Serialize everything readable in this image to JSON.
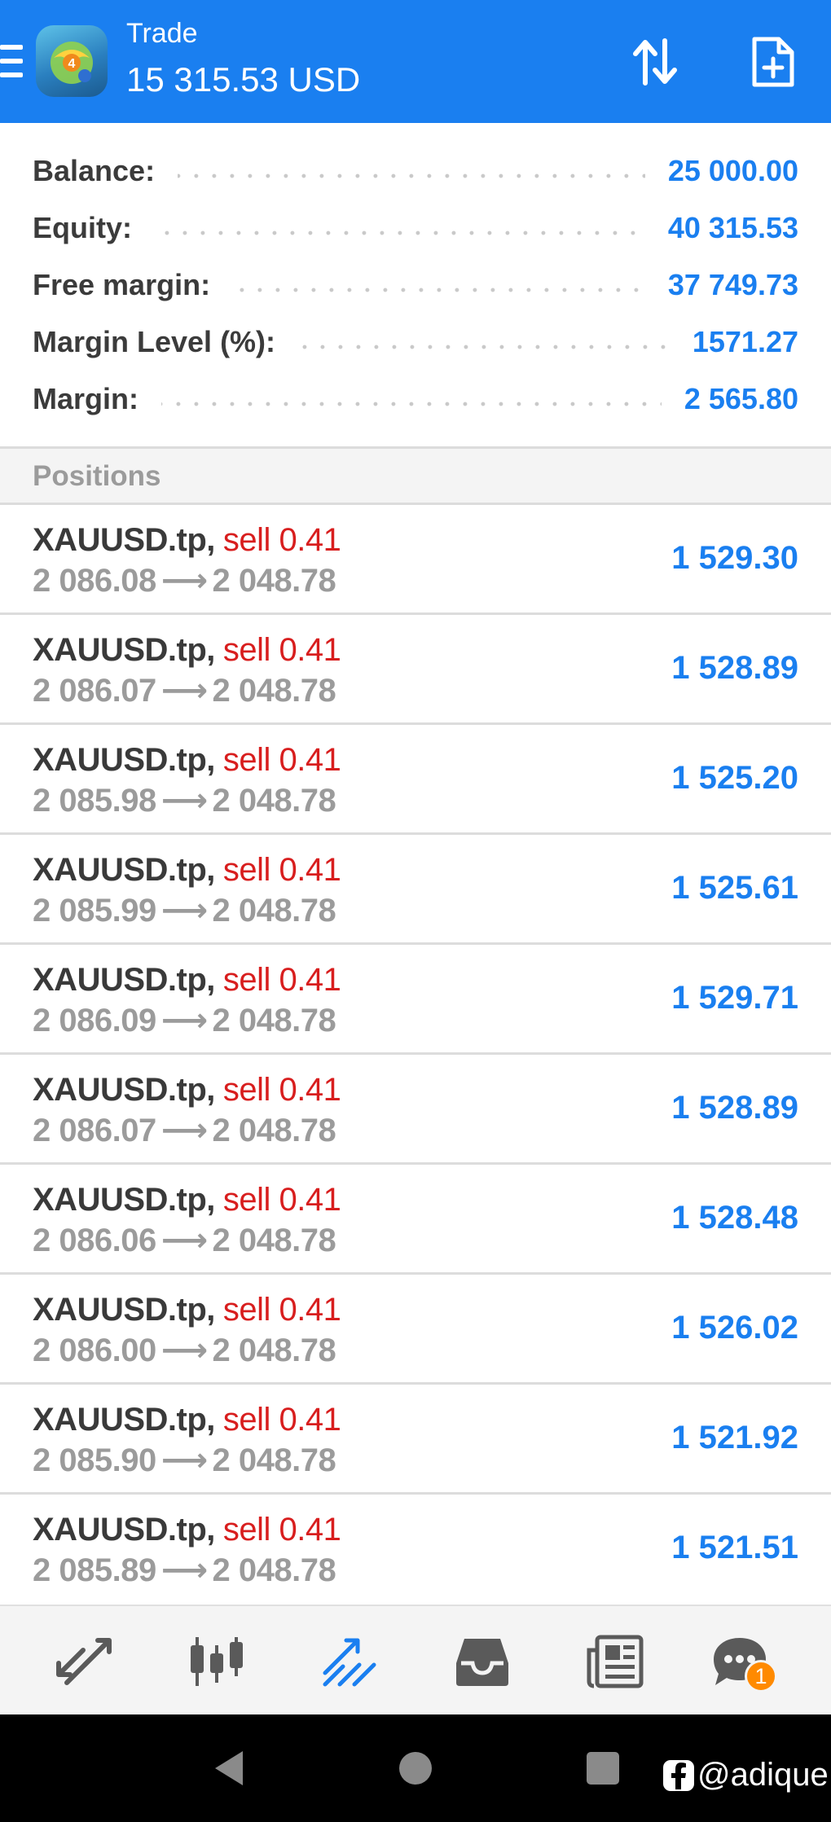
{
  "header": {
    "title": "Trade",
    "subtitle": "15 315.53 USD",
    "icons": [
      "menu-icon",
      "mt4-app-logo",
      "sort-icon",
      "new-order-icon"
    ]
  },
  "summary": [
    {
      "label": "Balance:",
      "value": "25 000.00"
    },
    {
      "label": "Equity:",
      "value": "40 315.53"
    },
    {
      "label": "Free margin:",
      "value": "37 749.73"
    },
    {
      "label": "Margin Level (%):",
      "value": "1571.27"
    },
    {
      "label": "Margin:",
      "value": "2 565.80"
    }
  ],
  "positions_header": "Positions",
  "positions": [
    {
      "symbol": "XAUUSD.tp",
      "side": "sell 0.41",
      "open": "2 086.08",
      "current": "2 048.78",
      "profit": "1 529.30"
    },
    {
      "symbol": "XAUUSD.tp",
      "side": "sell 0.41",
      "open": "2 086.07",
      "current": "2 048.78",
      "profit": "1 528.89"
    },
    {
      "symbol": "XAUUSD.tp",
      "side": "sell 0.41",
      "open": "2 085.98",
      "current": "2 048.78",
      "profit": "1 525.20"
    },
    {
      "symbol": "XAUUSD.tp",
      "side": "sell 0.41",
      "open": "2 085.99",
      "current": "2 048.78",
      "profit": "1 525.61"
    },
    {
      "symbol": "XAUUSD.tp",
      "side": "sell 0.41",
      "open": "2 086.09",
      "current": "2 048.78",
      "profit": "1 529.71"
    },
    {
      "symbol": "XAUUSD.tp",
      "side": "sell 0.41",
      "open": "2 086.07",
      "current": "2 048.78",
      "profit": "1 528.89"
    },
    {
      "symbol": "XAUUSD.tp",
      "side": "sell 0.41",
      "open": "2 086.06",
      "current": "2 048.78",
      "profit": "1 528.48"
    },
    {
      "symbol": "XAUUSD.tp",
      "side": "sell 0.41",
      "open": "2 086.00",
      "current": "2 048.78",
      "profit": "1 526.02"
    },
    {
      "symbol": "XAUUSD.tp",
      "side": "sell 0.41",
      "open": "2 085.90",
      "current": "2 048.78",
      "profit": "1 521.92"
    },
    {
      "symbol": "XAUUSD.tp",
      "side": "sell 0.41",
      "open": "2 085.89",
      "current": "2 048.78",
      "profit": "1 521.51"
    }
  ],
  "arrow_glyph": "⟶",
  "bottom_nav": {
    "items": [
      "quotes-icon",
      "chart-icon",
      "trade-icon",
      "history-icon",
      "news-icon",
      "messages-icon"
    ],
    "active": "trade-icon",
    "messages_badge": "1"
  },
  "system_bar": {
    "watermark": "@adique"
  },
  "colors": {
    "brand_blue": "#1a7ff0",
    "sell_red": "#d81e1e",
    "label_dark": "#3b3b3b",
    "muted_gray": "#9b9b9b",
    "badge_orange": "#ff8a00"
  }
}
